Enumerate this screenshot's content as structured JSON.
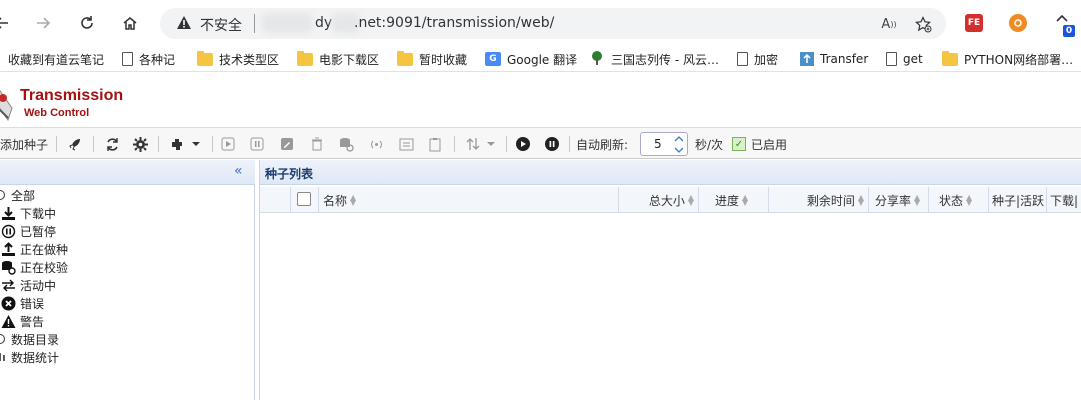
{
  "browser": {
    "url_security": "不安全",
    "url_part1": "dy",
    "url_part2": ".net:9091/transmission/web/",
    "ext_fe": "FE",
    "badge_count": "0"
  },
  "bookmarks": [
    {
      "label": "收藏到有道云笔记",
      "icon": "none"
    },
    {
      "label": "各种记",
      "icon": "page"
    },
    {
      "label": "技术类型区",
      "icon": "folder"
    },
    {
      "label": "电影下载区",
      "icon": "folder"
    },
    {
      "label": "暂时收藏",
      "icon": "folder"
    },
    {
      "label": "Google 翻译",
      "icon": "translate"
    },
    {
      "label": "三国志列传 - 风云…",
      "icon": "tree"
    },
    {
      "label": "加密",
      "icon": "page"
    },
    {
      "label": "Transfer",
      "icon": "upload"
    },
    {
      "label": "get",
      "icon": "page"
    },
    {
      "label": "PYTHON网络部署…",
      "icon": "folder"
    }
  ],
  "app": {
    "title": "Transmission",
    "subtitle": "Web Control"
  },
  "toolbar": {
    "add_torrent": "添加种子",
    "auto_refresh_label": "自动刷新:",
    "refresh_value": "5",
    "refresh_unit": "秒/次",
    "enabled_label": "已启用"
  },
  "sidebar": {
    "items": [
      {
        "label": "全部",
        "icon": "all-icon"
      },
      {
        "label": "下载中",
        "icon": "download-icon"
      },
      {
        "label": "已暂停",
        "icon": "pause-icon"
      },
      {
        "label": "正在做种",
        "icon": "upload-icon"
      },
      {
        "label": "正在校验",
        "icon": "verify-icon"
      },
      {
        "label": "活动中",
        "icon": "activity-icon"
      },
      {
        "label": "错误",
        "icon": "error-icon"
      },
      {
        "label": "警告",
        "icon": "warning-icon"
      },
      {
        "label": "数据目录",
        "icon": "folder-icon"
      },
      {
        "label": "数据统计",
        "icon": "stats-icon"
      }
    ]
  },
  "main": {
    "title": "种子列表",
    "columns": [
      "名称",
      "总大小",
      "进度",
      "剩余时间",
      "分享率",
      "状态",
      "种子|活跃",
      "下载|"
    ]
  }
}
